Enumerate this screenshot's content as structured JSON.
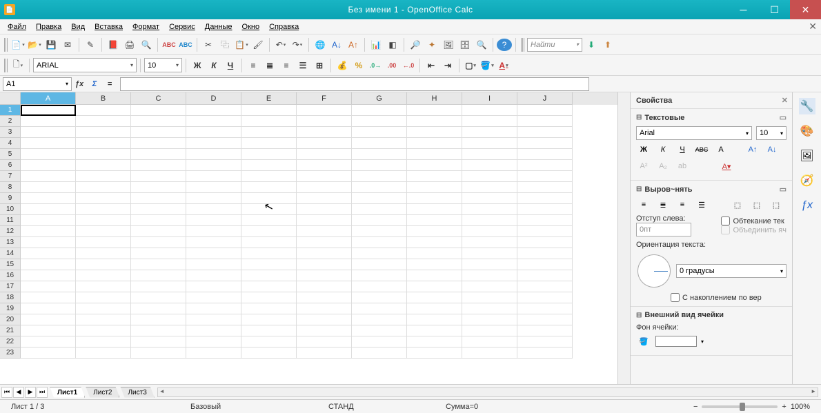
{
  "title": "Без имени 1 - OpenOffice Calc",
  "menu": [
    "Файл",
    "Правка",
    "Вид",
    "Вставка",
    "Формат",
    "Сервис",
    "Данные",
    "Окно",
    "Справка"
  ],
  "search_placeholder": "Найти",
  "font_name": "ARIAL",
  "font_size": "10",
  "cell_ref": "A1",
  "columns": [
    "A",
    "B",
    "C",
    "D",
    "E",
    "F",
    "G",
    "H",
    "I",
    "J"
  ],
  "rows": [
    "1",
    "2",
    "3",
    "4",
    "5",
    "6",
    "7",
    "8",
    "9",
    "10",
    "11",
    "12",
    "13",
    "14",
    "15",
    "16",
    "17",
    "18",
    "19",
    "20",
    "21",
    "22",
    "23"
  ],
  "tabs": [
    "Лист1",
    "Лист2",
    "Лист3"
  ],
  "active_tab": 0,
  "sidebar": {
    "title": "Свойства",
    "text_section": "Текстовые",
    "align_section": "Выров~нять",
    "indent_label": "Отступ слева:",
    "indent_value": "0пт",
    "wrap_label": "Обтекание тек",
    "merge_label": "Объединить яч",
    "orient_label": "Ориентация текста:",
    "orient_value": "0 градусы",
    "stacked_label": "С накоплением по вер",
    "cell_section": "Внешний вид ячейки",
    "fill_label": "Фон ячейки:",
    "font_name": "Arial",
    "font_size": "10"
  },
  "status": {
    "sheet": "Лист 1 / 3",
    "style": "Базовый",
    "mode": "СТАНД",
    "sum": "Сумма=0",
    "zoom": "100%"
  }
}
